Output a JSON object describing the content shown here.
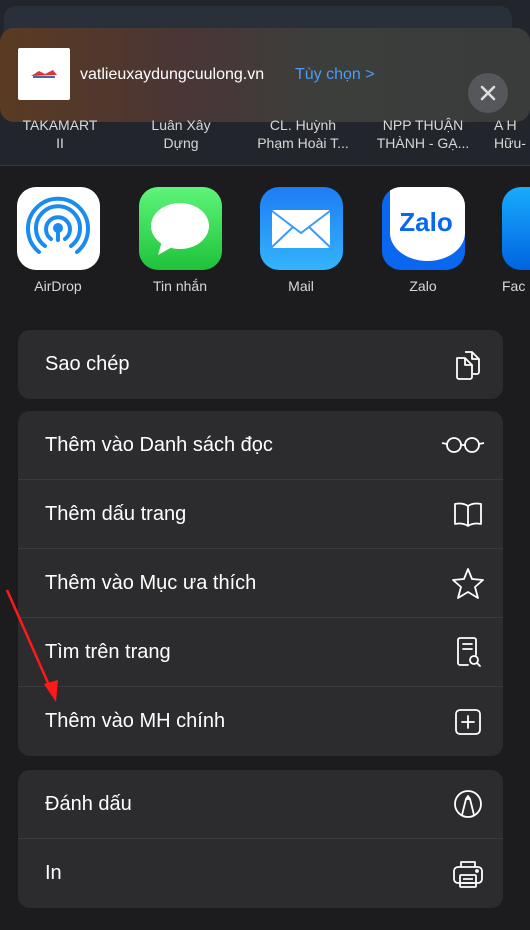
{
  "header": {
    "site": "vatlieuxaydungcuulong.vn",
    "options_label": "Tùy chọn",
    "options_chevron": ">"
  },
  "contacts": [
    {
      "line1": "TAKAMART",
      "line2": "II"
    },
    {
      "line1": "Luân Xây",
      "line2": "Dựng"
    },
    {
      "line1": "CL. Huỳnh",
      "line2": "Phạm Hoài T..."
    },
    {
      "line1": "NPP THUẬN",
      "line2": "THÀNH - GẠ..."
    },
    {
      "line1": "A H",
      "line2": "Hữu-"
    }
  ],
  "apps": [
    {
      "label": "AirDrop",
      "icon": "airdrop-icon"
    },
    {
      "label": "Tin nhắn",
      "icon": "messages-icon"
    },
    {
      "label": "Mail",
      "icon": "mail-icon"
    },
    {
      "label": "Zalo",
      "icon": "zalo-icon",
      "text": "Zalo"
    },
    {
      "label": "Fac",
      "icon": "facebook-icon"
    }
  ],
  "actions": {
    "group1": [
      {
        "label": "Sao chép",
        "icon": "copy-icon"
      }
    ],
    "group2": [
      {
        "label": "Thêm vào Danh sách đọc",
        "icon": "glasses-icon"
      },
      {
        "label": "Thêm dấu trang",
        "icon": "book-icon"
      },
      {
        "label": "Thêm vào Mục ưa thích",
        "icon": "star-icon"
      },
      {
        "label": "Tìm trên trang",
        "icon": "find-on-page-icon"
      },
      {
        "label": "Thêm vào MH chính",
        "icon": "add-square-icon"
      }
    ],
    "group3": [
      {
        "label": "Đánh dấu",
        "icon": "markup-icon"
      },
      {
        "label": "In",
        "icon": "printer-icon"
      }
    ]
  },
  "colors": {
    "accent": "#4a9cf5",
    "annotation_arrow": "#ff1a1a",
    "cell": "#2c2c2e",
    "background": "#1c1c1e"
  }
}
